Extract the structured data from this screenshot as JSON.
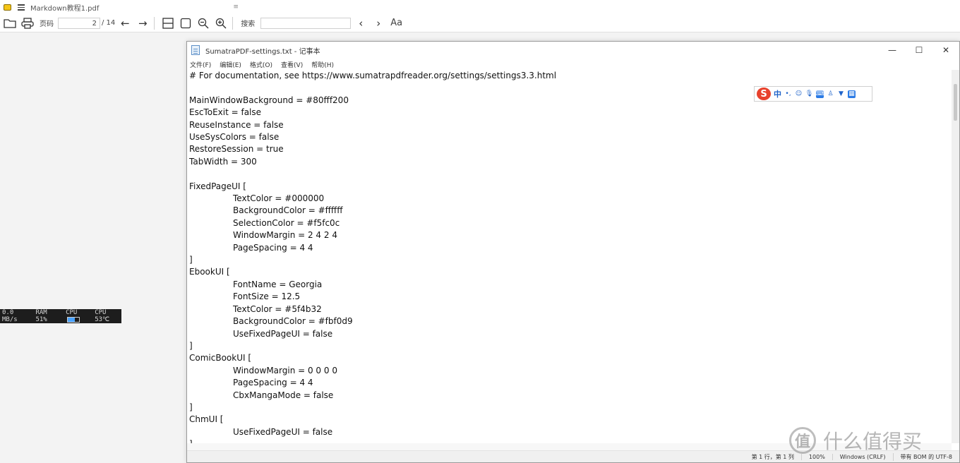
{
  "sumatra": {
    "title": "Markdown教程1.pdf",
    "pin": "≡",
    "toolbar": {
      "page_label": "页码",
      "page_current": "2",
      "page_total": "/ 14",
      "find_label": "搜索",
      "find_value": "",
      "text_size_label": "Aa"
    },
    "status_strip": {
      "net": "RAM 51%",
      "cpu_label": "CPU",
      "temp": "CPU 53℃",
      "first": "0.0 MB/s"
    }
  },
  "notepad": {
    "title": "SumatraPDF-settings.txt - 记事本",
    "menu": [
      "文件(F)",
      "编辑(E)",
      "格式(O)",
      "查看(V)",
      "帮助(H)"
    ],
    "lines": [
      {
        "text": "# For documentation, see https://www.sumatrapdfreader.org/settings/settings3.3.html",
        "indent": false
      },
      {
        "text": "",
        "indent": false
      },
      {
        "text": "MainWindowBackground = #80fff200",
        "indent": false
      },
      {
        "text": "EscToExit = false",
        "indent": false
      },
      {
        "text": "ReuseInstance = false",
        "indent": false
      },
      {
        "text": "UseSysColors = false",
        "indent": false
      },
      {
        "text": "RestoreSession = true",
        "indent": false
      },
      {
        "text": "TabWidth = 300",
        "indent": false
      },
      {
        "text": "",
        "indent": false
      },
      {
        "text": "FixedPageUI [",
        "indent": false
      },
      {
        "text": "TextColor = #000000",
        "indent": true
      },
      {
        "text": "BackgroundColor = #ffffff",
        "indent": true
      },
      {
        "text": "SelectionColor = #f5fc0c",
        "indent": true
      },
      {
        "text": "WindowMargin = 2 4 2 4",
        "indent": true
      },
      {
        "text": "PageSpacing = 4 4",
        "indent": true
      },
      {
        "text": "]",
        "indent": false
      },
      {
        "text": "EbookUI [",
        "indent": false
      },
      {
        "text": "FontName = Georgia",
        "indent": true
      },
      {
        "text": "FontSize = 12.5",
        "indent": true
      },
      {
        "text": "TextColor = #5f4b32",
        "indent": true
      },
      {
        "text": "BackgroundColor = #fbf0d9",
        "indent": true
      },
      {
        "text": "UseFixedPageUI = false",
        "indent": true
      },
      {
        "text": "]",
        "indent": false
      },
      {
        "text": "ComicBookUI [",
        "indent": false
      },
      {
        "text": "WindowMargin = 0 0 0 0",
        "indent": true
      },
      {
        "text": "PageSpacing = 4 4",
        "indent": true
      },
      {
        "text": "CbxMangaMode = false",
        "indent": true
      },
      {
        "text": "]",
        "indent": false
      },
      {
        "text": "ChmUI [",
        "indent": false
      },
      {
        "text": "UseFixedPageUI = false",
        "indent": true
      },
      {
        "text": "]",
        "indent": false
      }
    ],
    "status": {
      "position": "第 1 行，第 1 列",
      "zoom": "100%",
      "eol": "Windows (CRLF)",
      "encoding": "带有 BOM 的 UTF-8"
    }
  },
  "ime": {
    "logo": "S",
    "mode": "中"
  },
  "watermark": {
    "seal": "值",
    "text": "什么值得买"
  }
}
